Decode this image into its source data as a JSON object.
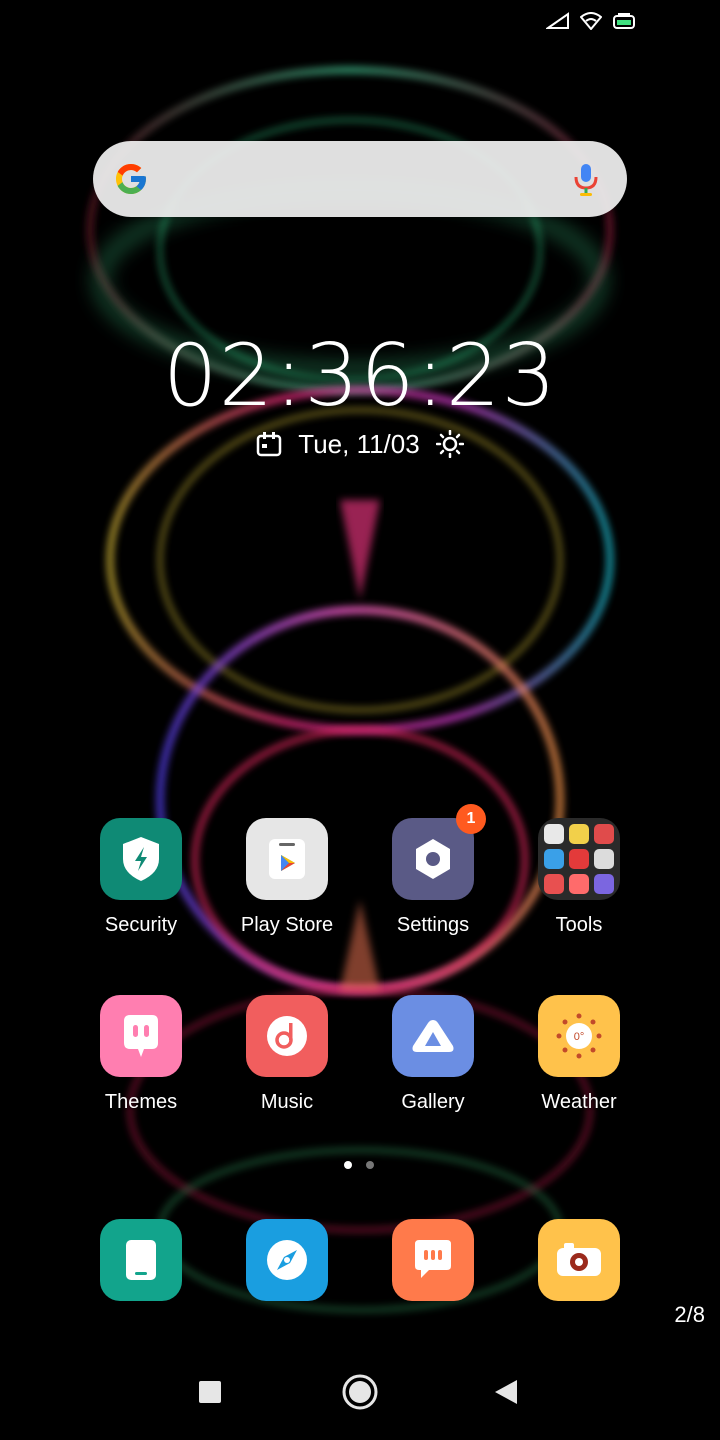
{
  "status_bar": {
    "icons": [
      "signal-icon",
      "wifi-icon",
      "battery-icon"
    ]
  },
  "search": {
    "logo": "google-g-icon",
    "voice": "mic-icon"
  },
  "clock": {
    "time": "02:36:23",
    "date": "Tue, 11/03",
    "calendar_icon": "calendar-icon",
    "weather_icon": "sun-icon"
  },
  "apps": [
    {
      "label": "Security",
      "icon": "security-shield-icon",
      "color": "#0f8a75"
    },
    {
      "label": "Play Store",
      "icon": "play-store-icon",
      "color": "#e6e6e6"
    },
    {
      "label": "Settings",
      "icon": "settings-hexagon-icon",
      "color": "#5a5a86",
      "badge": "1"
    },
    {
      "label": "Tools",
      "icon": "folder-icon",
      "color": "#2a2a2a"
    },
    {
      "label": "Themes",
      "icon": "themes-icon",
      "color": "#ff7eb0"
    },
    {
      "label": "Music",
      "icon": "music-note-icon",
      "color": "#f15e5e"
    },
    {
      "label": "Gallery",
      "icon": "gallery-icon",
      "color": "#6b8ee3"
    },
    {
      "label": "Weather",
      "icon": "weather-sun-icon",
      "color": "#ffc24b",
      "temp": "0°"
    }
  ],
  "dock": [
    {
      "name": "phone",
      "icon": "phone-icon",
      "color": "#12a48c"
    },
    {
      "name": "browser",
      "icon": "compass-icon",
      "color": "#1a9ee0"
    },
    {
      "name": "messages",
      "icon": "message-icon",
      "color": "#ff7a4b"
    },
    {
      "name": "camera",
      "icon": "camera-icon",
      "color": "#ffc24b"
    }
  ],
  "page_indicator": {
    "current": 1,
    "total_dots": 2
  },
  "page_counter": "2/8",
  "nav": {
    "recent": "square-icon",
    "home": "circle-icon",
    "back": "triangle-back-icon"
  }
}
